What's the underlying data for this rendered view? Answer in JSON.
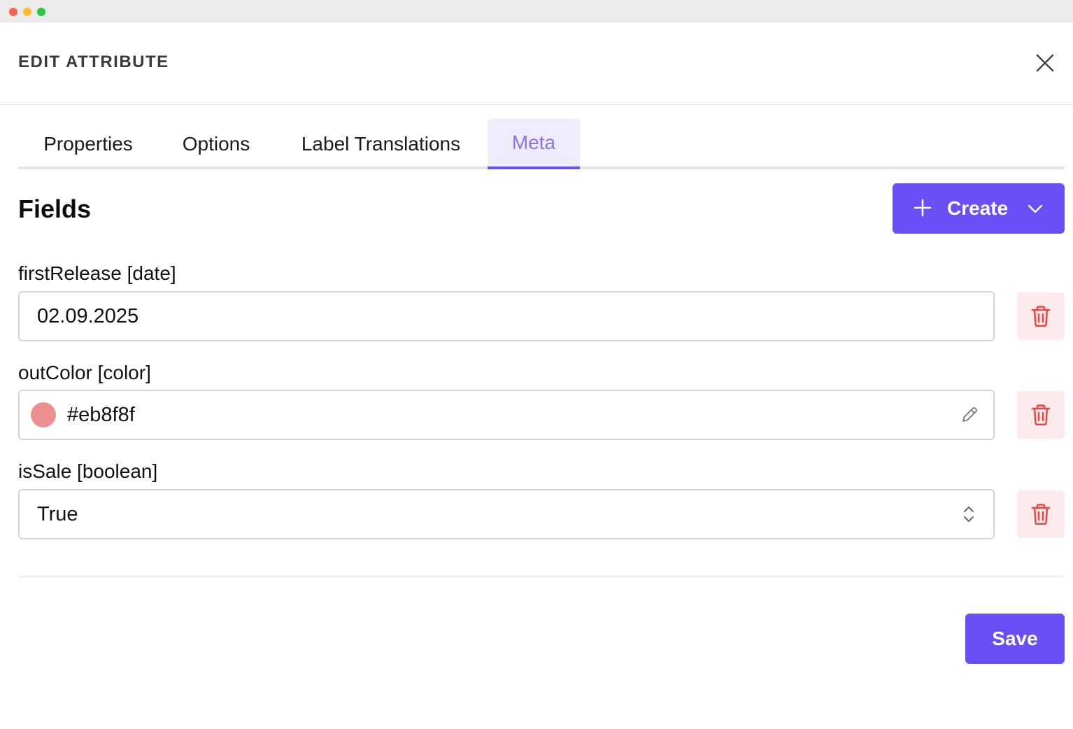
{
  "dialog": {
    "title": "EDIT ATTRIBUTE",
    "close_icon": "close-icon"
  },
  "tabs": [
    {
      "label": "Properties",
      "active": false
    },
    {
      "label": "Options",
      "active": false
    },
    {
      "label": "Label Translations",
      "active": false
    },
    {
      "label": "Meta",
      "active": true
    }
  ],
  "section": {
    "title": "Fields",
    "create_label": "Create",
    "create_icons": [
      "plus-icon",
      "chevron-down-icon"
    ]
  },
  "fields": [
    {
      "label": "firstRelease [date]",
      "value": "02.09.2025",
      "type": "date"
    },
    {
      "label": "outColor [color]",
      "value": "#eb8f8f",
      "type": "color",
      "swatch_color": "#eb8f8f"
    },
    {
      "label": "isSale [boolean]",
      "value": "True",
      "type": "select"
    }
  ],
  "footer": {
    "save_label": "Save"
  },
  "colors": {
    "accent": "#6a4ff6",
    "active_tab_text": "#8b73ef",
    "active_tab_bg": "#efecfd",
    "delete_bg": "#fdeaea",
    "delete_icon": "#ef4444"
  }
}
